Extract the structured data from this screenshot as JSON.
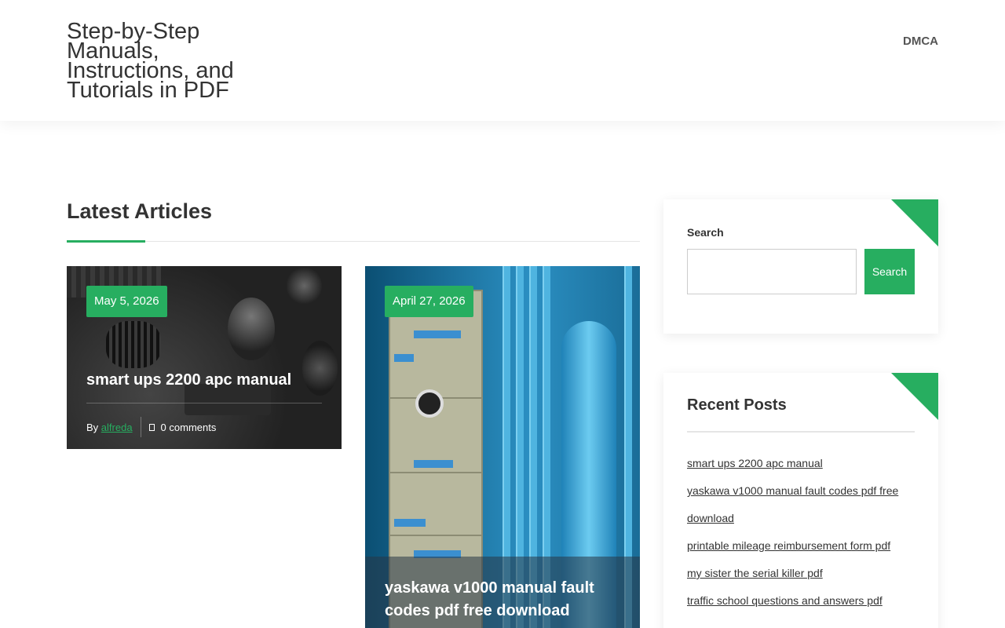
{
  "header": {
    "site_title": "Step-by-Step Manuals, Instructions, and Tutorials in PDF",
    "nav": [
      "DMCA"
    ]
  },
  "main": {
    "section_title": "Latest Articles",
    "articles": [
      {
        "date": "May 5, 2026",
        "title": "smart ups 2200 apc manual",
        "by_label": "By",
        "author": "alfreda",
        "comments": "0 comments"
      },
      {
        "date": "April 27, 2026",
        "title": "yaskawa v1000 manual fault codes pdf free download"
      }
    ]
  },
  "sidebar": {
    "search": {
      "label": "Search",
      "input_value": "",
      "button_label": "Search"
    },
    "recent_posts": {
      "title": "Recent Posts",
      "items": [
        "smart ups 2200 apc manual",
        "yaskawa v1000 manual fault codes pdf free download",
        "printable mileage reimbursement form pdf",
        "my sister the serial killer pdf",
        "traffic school questions and answers pdf"
      ]
    }
  },
  "colors": {
    "accent": "#27ae60",
    "text": "#333333"
  },
  "icons": {
    "comment": "comment-icon"
  }
}
